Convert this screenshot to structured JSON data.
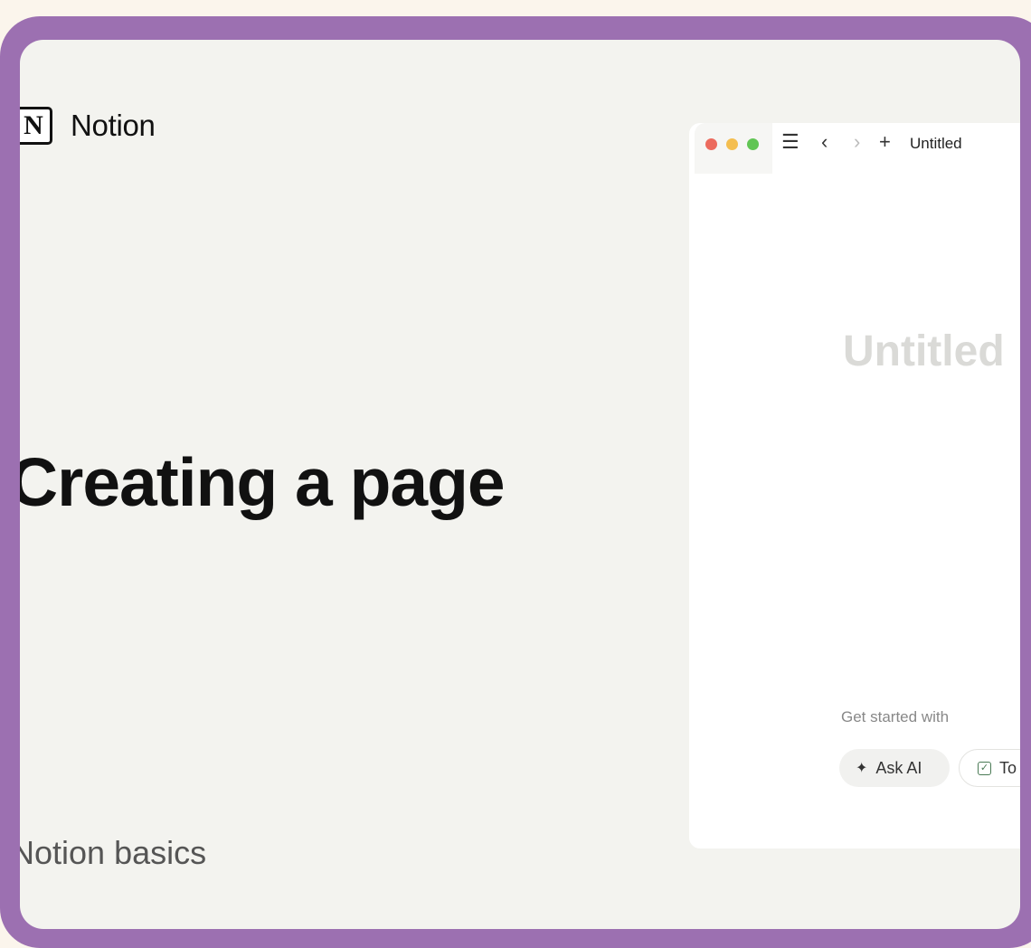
{
  "brand": {
    "name": "Notion",
    "logo_letter": "N"
  },
  "page": {
    "title": "Creating a page",
    "subtitle": "Notion basics"
  },
  "window": {
    "tab_title": "Untitled",
    "page_heading": "Untitled",
    "get_started_label": "Get started with",
    "chips": [
      {
        "label": "Ask AI",
        "icon": "sparkle-icon"
      },
      {
        "label": "To",
        "icon": "checkbox-icon"
      }
    ]
  },
  "colors": {
    "outer_border": "#9c70b1",
    "panel_bg": "#f3f3ef",
    "traffic_red": "#ec6b5e",
    "traffic_yellow": "#f4be4f",
    "traffic_green": "#61c554"
  }
}
